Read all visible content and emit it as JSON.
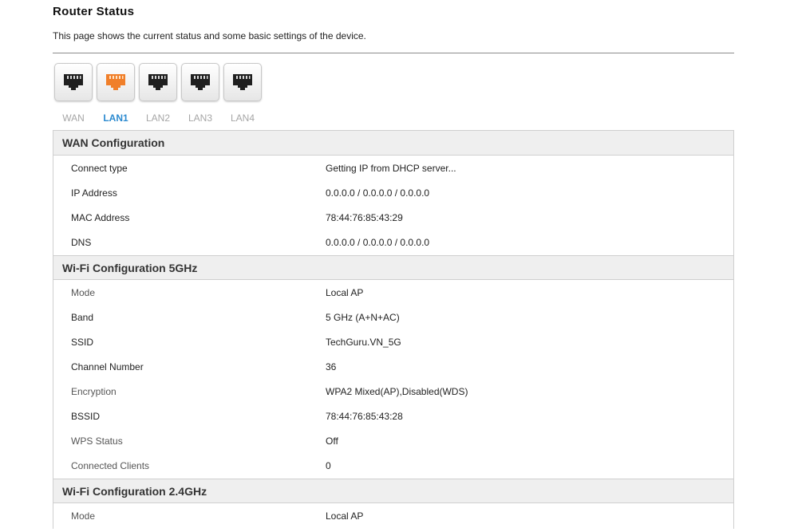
{
  "page": {
    "title": "Router Status",
    "description": "This page shows the current status and some basic settings of the device."
  },
  "ports": {
    "active_color": "#f07f2a",
    "inactive_color": "#1f1f1f",
    "items": [
      {
        "label": "WAN",
        "active": false
      },
      {
        "label": "LAN1",
        "active": true
      },
      {
        "label": "LAN2",
        "active": false
      },
      {
        "label": "LAN3",
        "active": false
      },
      {
        "label": "LAN4",
        "active": false
      }
    ]
  },
  "wan": {
    "title": "WAN Configuration",
    "rows": [
      {
        "label": "Connect type",
        "value": "Getting IP from DHCP server..."
      },
      {
        "label": "IP Address",
        "value": "0.0.0.0 / 0.0.0.0 / 0.0.0.0"
      },
      {
        "label": "MAC Address",
        "value": "78:44:76:85:43:29"
      },
      {
        "label": "DNS",
        "value": "0.0.0.0 / 0.0.0.0 / 0.0.0.0"
      }
    ]
  },
  "wifi5": {
    "title": "Wi-Fi Configuration 5GHz",
    "rows": [
      {
        "label": "Mode",
        "value": "Local AP"
      },
      {
        "label": "Band",
        "value": "5 GHz (A+N+AC)"
      },
      {
        "label": "SSID",
        "value": "TechGuru.VN_5G"
      },
      {
        "label": "Channel Number",
        "value": "36"
      },
      {
        "label": "Encryption",
        "value": "WPA2 Mixed(AP),Disabled(WDS)"
      },
      {
        "label": "BSSID",
        "value": "78:44:76:85:43:28"
      },
      {
        "label": "WPS Status",
        "value": "Off"
      },
      {
        "label": "Connected Clients",
        "value": "0"
      }
    ]
  },
  "wifi24": {
    "title": "Wi-Fi Configuration 2.4GHz",
    "rows": [
      {
        "label": "Mode",
        "value": "Local AP"
      }
    ]
  }
}
